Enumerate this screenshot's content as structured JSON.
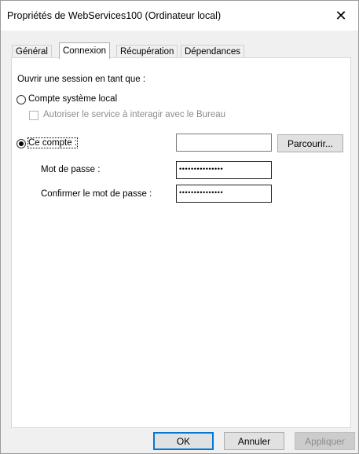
{
  "window": {
    "title": "Propriétés de WebServices100 (Ordinateur local)",
    "close_glyph": "✕"
  },
  "tabs": [
    {
      "label": "Général",
      "active": false
    },
    {
      "label": "Connexion",
      "active": true
    },
    {
      "label": "Récupération",
      "active": false
    },
    {
      "label": "Dépendances",
      "active": false
    }
  ],
  "logon": {
    "heading": "Ouvrir une session en tant que :",
    "local_system": {
      "label": "Compte système local",
      "selected": false
    },
    "allow_desktop": {
      "label": "Autoriser le service à interagir avec le Bureau",
      "checked": false,
      "enabled": false
    },
    "this_account": {
      "label": "Ce compte :",
      "selected": true,
      "value": ""
    },
    "browse_label": "Parcourir...",
    "password": {
      "label": "Mot de passe :",
      "masked_value": "•••••••••••••••"
    },
    "confirm_password": {
      "label": "Confirmer le mot de passe :",
      "masked_value": "•••••••••••••••"
    }
  },
  "footer": {
    "ok_label": "OK",
    "cancel_label": "Annuler",
    "apply_label": "Appliquer",
    "apply_enabled": false
  },
  "colors": {
    "window_bg": "#f0f0f0",
    "panel_bg": "#ffffff",
    "accent": "#0078d7",
    "disabled_text": "#8c8c8c"
  }
}
